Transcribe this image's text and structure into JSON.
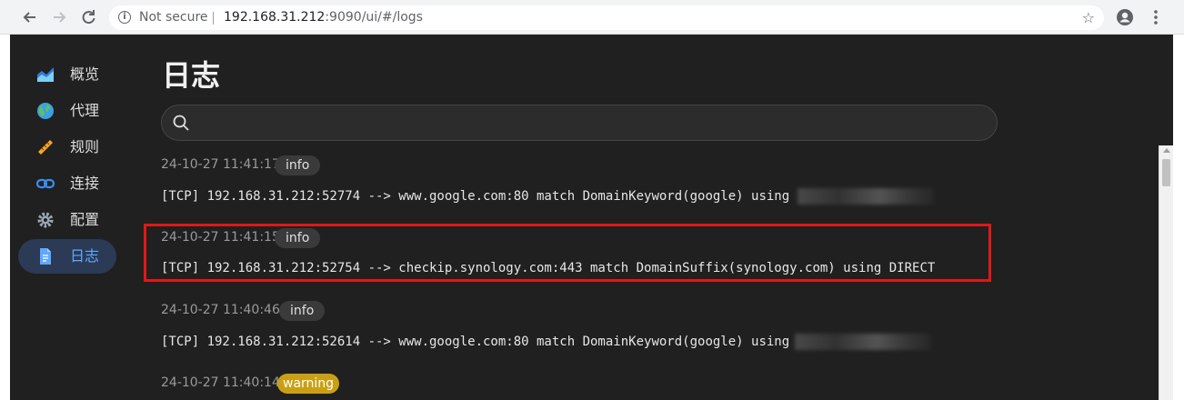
{
  "browser": {
    "security_label": "Not secure",
    "host": "192.168.31.212",
    "path": ":9090/ui/#/logs"
  },
  "sidebar": {
    "items": [
      {
        "label": "概览",
        "icon": "chart-icon"
      },
      {
        "label": "代理",
        "icon": "globe-icon"
      },
      {
        "label": "规则",
        "icon": "ruler-icon"
      },
      {
        "label": "连接",
        "icon": "link-icon"
      },
      {
        "label": "配置",
        "icon": "gear-icon"
      },
      {
        "label": "日志",
        "icon": "document-icon",
        "active": true
      }
    ]
  },
  "page": {
    "title": "日志",
    "search_placeholder": ""
  },
  "logs": [
    {
      "time": "24-10-27 11:41:17",
      "level": "info",
      "message": "[TCP] 192.168.31.212:52774 --> www.google.com:80 match DomainKeyword(google) using "
    },
    {
      "time": "24-10-27 11:41:15",
      "level": "info",
      "message": "[TCP] 192.168.31.212:52754 --> checkip.synology.com:443 match DomainSuffix(synology.com) using DIRECT"
    },
    {
      "time": "24-10-27 11:40:46",
      "level": "info",
      "message": "[TCP] 192.168.31.212:52614 --> www.google.com:80 match DomainKeyword(google) using"
    },
    {
      "time": "24-10-27 11:40:14",
      "level": "warning",
      "message": ""
    }
  ],
  "colors": {
    "background": "#202020",
    "accent": "#5fa8ff",
    "highlight_border": "#e01818",
    "warning": "#c9a015"
  }
}
